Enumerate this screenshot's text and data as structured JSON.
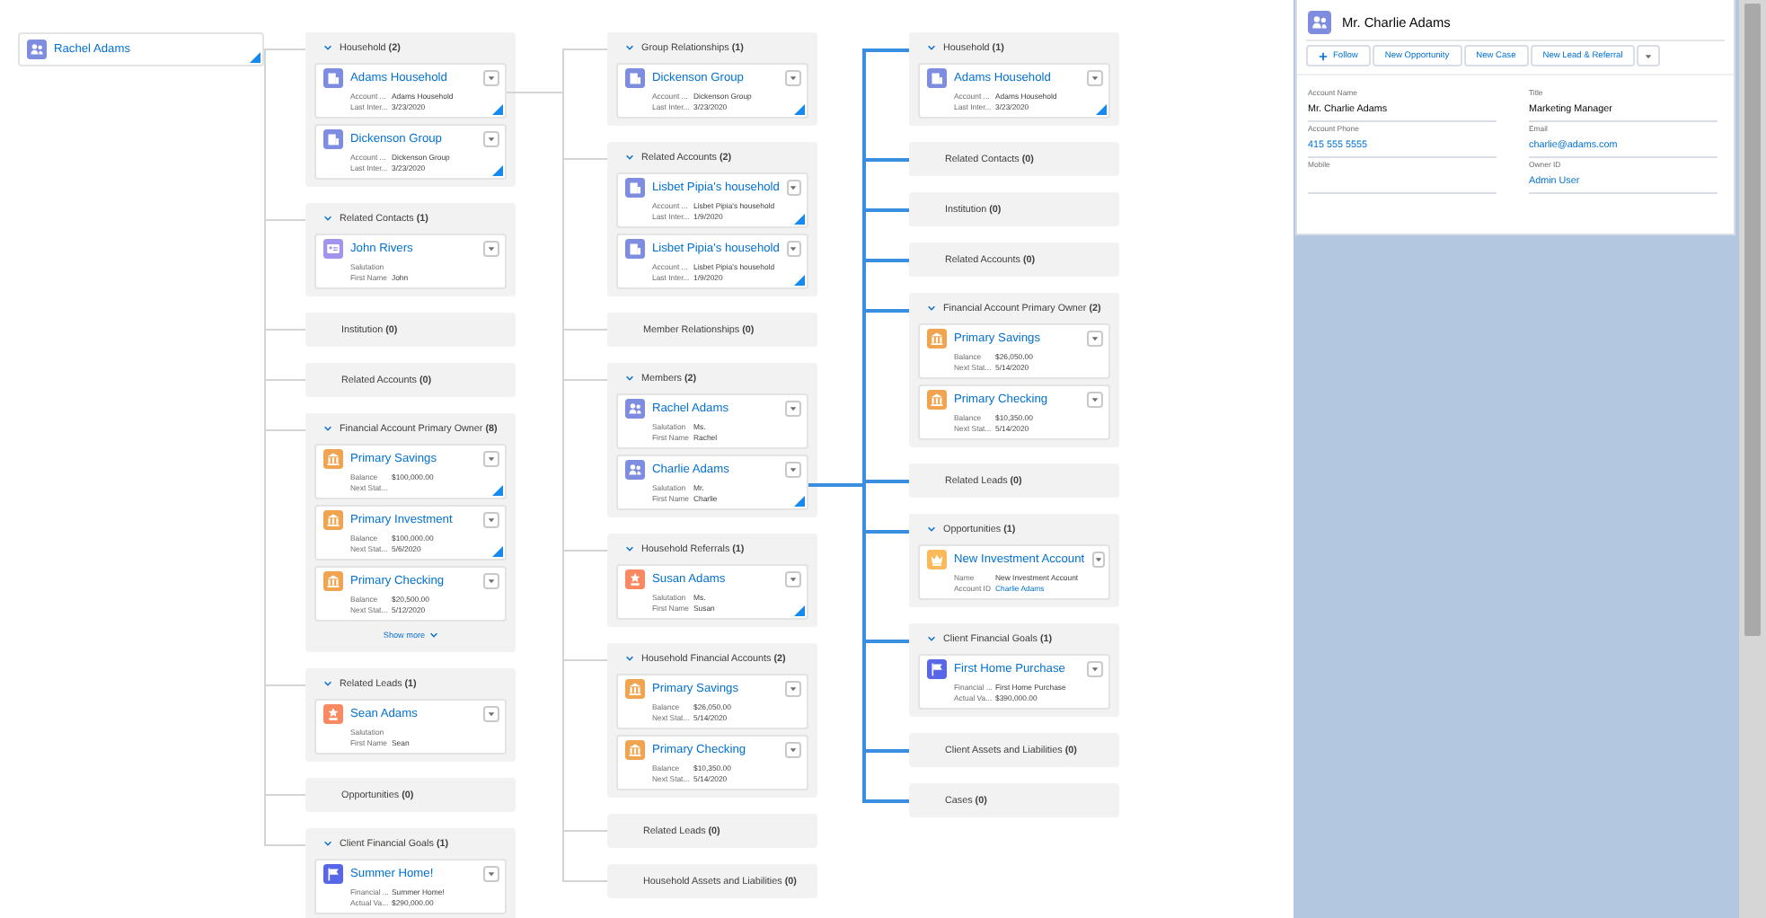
{
  "root_record": {
    "title": "Rachel Adams",
    "kind": "person_account",
    "expandable": true
  },
  "columns": [
    {
      "highlighted": false,
      "groups": [
        {
          "title": "Household **(2)**",
          "expanded": true,
          "cards": [
            {
              "title": "Adams Household",
              "kind": "account",
              "expandable": true,
              "expanded": true,
              "fields": [
                {
                  "label": "Account ...",
                  "value": "Adams Household",
                  "kind": "text"
                },
                {
                  "label": "Last Inter...",
                  "value": "3/23/2020",
                  "kind": "text"
                }
              ]
            },
            {
              "title": "Dickenson Group",
              "kind": "account",
              "expandable": true,
              "expanded": false,
              "fields": [
                {
                  "label": "Account ...",
                  "value": "Dickenson Group",
                  "kind": "text"
                },
                {
                  "label": "Last Inter...",
                  "value": "3/23/2020",
                  "kind": "text"
                }
              ]
            }
          ]
        },
        {
          "title": "Related Contacts **(1)**",
          "expanded": true,
          "cards": [
            {
              "title": "John Rivers",
              "kind": "contact",
              "expandable": false,
              "expanded": false,
              "fields": [
                {
                  "label": "Salutation"
                },
                {
                  "label": "First Name",
                  "value": "John",
                  "kind": "text"
                }
              ]
            }
          ]
        },
        {
          "title": "Institution **(0)**",
          "expanded": false
        },
        {
          "title": "Related Accounts **(0)**",
          "expanded": false
        },
        {
          "title": "Financial Account Primary Owner **(8)**",
          "expanded": true,
          "show_more": "Show more",
          "cards": [
            {
              "title": "Primary Savings",
              "kind": "financial_account",
              "expandable": true,
              "expanded": false,
              "fields": [
                {
                  "label": "Balance",
                  "value": "$100,000.00",
                  "kind": "text"
                },
                {
                  "label": "Next Stat..."
                }
              ]
            },
            {
              "title": "Primary Investment",
              "kind": "financial_account",
              "expandable": true,
              "expanded": false,
              "fields": [
                {
                  "label": "Balance",
                  "value": "$100,000.00",
                  "kind": "text"
                },
                {
                  "label": "Next Stat...",
                  "value": "5/6/2020",
                  "kind": "text"
                }
              ]
            },
            {
              "title": "Primary Checking",
              "kind": "financial_account",
              "expandable": false,
              "expanded": false,
              "fields": [
                {
                  "label": "Balance",
                  "value": "$20,500.00",
                  "kind": "text"
                },
                {
                  "label": "Next Stat...",
                  "value": "5/12/2020",
                  "kind": "text"
                }
              ]
            }
          ]
        },
        {
          "title": "Related Leads **(1)**",
          "expanded": true,
          "cards": [
            {
              "title": "Sean Adams",
              "kind": "lead",
              "expandable": false,
              "expanded": false,
              "fields": [
                {
                  "label": "Salutation"
                },
                {
                  "label": "First Name",
                  "value": "Sean",
                  "kind": "text"
                }
              ]
            }
          ]
        },
        {
          "title": "Opportunities **(0)**",
          "expanded": false
        },
        {
          "title": "Client Financial Goals **(1)**",
          "expanded": true,
          "cards": [
            {
              "title": "Summer Home!",
              "kind": "goal",
              "expandable": false,
              "expanded": false,
              "fields": [
                {
                  "label": "Financial ...",
                  "value": "Summer Home!",
                  "kind": "text"
                },
                {
                  "label": "Actual Va...",
                  "value": "$290,000.00",
                  "kind": "text"
                }
              ]
            }
          ]
        }
      ]
    },
    {
      "highlighted": false,
      "groups": [
        {
          "title": "Group Relationships **(1)**",
          "expanded": true,
          "cards": [
            {
              "title": "Dickenson Group",
              "kind": "account",
              "expandable": true,
              "expanded": false,
              "fields": [
                {
                  "label": "Account ...",
                  "value": "Dickenson Group",
                  "kind": "text"
                },
                {
                  "label": "Last Inter...",
                  "value": "3/23/2020",
                  "kind": "text"
                }
              ]
            }
          ]
        },
        {
          "title": "Related Accounts **(2)**",
          "expanded": true,
          "cards": [
            {
              "title": "Lisbet Pipia's household",
              "kind": "account",
              "expandable": true,
              "expanded": false,
              "fields": [
                {
                  "label": "Account ...",
                  "value": "Lisbet Pipia's household",
                  "kind": "text"
                },
                {
                  "label": "Last Inter...",
                  "value": "1/9/2020",
                  "kind": "text"
                }
              ]
            },
            {
              "title": "Lisbet Pipia's household",
              "kind": "account",
              "expandable": true,
              "expanded": false,
              "fields": [
                {
                  "label": "Account ...",
                  "value": "Lisbet Pipia's household",
                  "kind": "text"
                },
                {
                  "label": "Last Inter...",
                  "value": "1/9/2020",
                  "kind": "text"
                }
              ]
            }
          ]
        },
        {
          "title": "Member Relationships **(0)**",
          "expanded": false
        },
        {
          "title": "Members **(2)**",
          "expanded": true,
          "cards": [
            {
              "title": "Rachel Adams",
              "kind": "person_account",
              "expandable": false,
              "expanded": false,
              "fields": [
                {
                  "label": "Salutation",
                  "value": "Ms.",
                  "kind": "text"
                },
                {
                  "label": "First Name",
                  "value": "Rachel",
                  "kind": "text"
                }
              ]
            },
            {
              "title": "Charlie Adams",
              "kind": "person_account",
              "expandable": true,
              "expanded": true,
              "fields": [
                {
                  "label": "Salutation",
                  "value": "Mr.",
                  "kind": "text"
                },
                {
                  "label": "First Name",
                  "value": "Charlie",
                  "kind": "text"
                }
              ]
            }
          ]
        },
        {
          "title": "Household Referrals **(1)**",
          "expanded": true,
          "cards": [
            {
              "title": "Susan Adams",
              "kind": "lead",
              "expandable": true,
              "expanded": false,
              "fields": [
                {
                  "label": "Salutation",
                  "value": "Ms.",
                  "kind": "text"
                },
                {
                  "label": "First Name",
                  "value": "Susan",
                  "kind": "text"
                }
              ]
            }
          ]
        },
        {
          "title": "Household Financial Accounts **(2)**",
          "expanded": true,
          "cards": [
            {
              "title": "Primary Savings",
              "kind": "financial_account",
              "expandable": false,
              "expanded": false,
              "fields": [
                {
                  "label": "Balance",
                  "value": "$26,050.00",
                  "kind": "text"
                },
                {
                  "label": "Next Stat...",
                  "value": "5/14/2020",
                  "kind": "text"
                }
              ]
            },
            {
              "title": "Primary Checking",
              "kind": "financial_account",
              "expandable": false,
              "expanded": false,
              "fields": [
                {
                  "label": "Balance",
                  "value": "$10,350.00",
                  "kind": "text"
                },
                {
                  "label": "Next Stat...",
                  "value": "5/14/2020",
                  "kind": "text"
                }
              ]
            }
          ]
        },
        {
          "title": "Related Leads **(0)**",
          "expanded": false
        },
        {
          "title": "Household Assets and Liabilities **(0)**",
          "expanded": false
        }
      ]
    },
    {
      "highlighted": true,
      "groups": [
        {
          "title": "Household **(1)**",
          "expanded": true,
          "cards": [
            {
              "title": "Adams Household",
              "kind": "account",
              "expandable": true,
              "expanded": false,
              "fields": [
                {
                  "label": "Account ...",
                  "value": "Adams Household",
                  "kind": "text"
                },
                {
                  "label": "Last Inter...",
                  "value": "3/23/2020",
                  "kind": "text"
                }
              ]
            }
          ]
        },
        {
          "title": "Related Contacts **(0)**",
          "expanded": false
        },
        {
          "title": "Institution **(0)**",
          "expanded": false
        },
        {
          "title": "Related Accounts **(0)**",
          "expanded": false
        },
        {
          "title": "Financial Account Primary Owner **(2)**",
          "expanded": true,
          "cards": [
            {
              "title": "Primary Savings",
              "kind": "financial_account",
              "expandable": false,
              "expanded": false,
              "fields": [
                {
                  "label": "Balance",
                  "value": "$26,050.00",
                  "kind": "text"
                },
                {
                  "label": "Next Stat...",
                  "value": "5/14/2020",
                  "kind": "text"
                }
              ]
            },
            {
              "title": "Primary Checking",
              "kind": "financial_account",
              "expandable": false,
              "expanded": false,
              "fields": [
                {
                  "label": "Balance",
                  "value": "$10,350.00",
                  "kind": "text"
                },
                {
                  "label": "Next Stat...",
                  "value": "5/14/2020",
                  "kind": "text"
                }
              ]
            }
          ]
        },
        {
          "title": "Related Leads **(0)**",
          "expanded": false
        },
        {
          "title": "Opportunities **(1)**",
          "expanded": true,
          "cards": [
            {
              "title": "New Investment Account",
              "kind": "opportunity",
              "expandable": false,
              "expanded": false,
              "fields": [
                {
                  "label": "Name",
                  "value": "New Investment Account",
                  "kind": "text"
                },
                {
                  "label": "Account ID",
                  "value": "Charlie Adams",
                  "kind": "link"
                }
              ]
            }
          ]
        },
        {
          "title": "Client Financial Goals **(1)**",
          "expanded": true,
          "cards": [
            {
              "title": "First Home Purchase",
              "kind": "goal",
              "expandable": false,
              "expanded": false,
              "fields": [
                {
                  "label": "Financial ...",
                  "value": "First Home Purchase",
                  "kind": "text"
                },
                {
                  "label": "Actual Va...",
                  "value": "$390,000.00",
                  "kind": "text"
                }
              ]
            }
          ]
        },
        {
          "title": "Client Assets and Liabilities **(0)**",
          "expanded": false
        },
        {
          "title": "Cases **(0)**",
          "expanded": false
        }
      ]
    }
  ],
  "detail_panel": {
    "title": "Mr. Charlie Adams",
    "kind": "person_account",
    "actions": [
      {
        "label": "Follow",
        "kind": "follow"
      },
      {
        "label": "New Opportunity",
        "kind": "action"
      },
      {
        "label": "New Case",
        "kind": "action"
      },
      {
        "label": "New Lead & Referral",
        "kind": "action"
      }
    ],
    "fields": [
      {
        "label": "Account Name",
        "value": "Mr. Charlie Adams",
        "kind": "text"
      },
      {
        "label": "Title",
        "value": "Marketing Manager",
        "kind": "text"
      },
      {
        "label": "Account Phone",
        "value": "415 555 5555",
        "kind": "link"
      },
      {
        "label": "Email",
        "value": "charlie@adams.com",
        "kind": "link"
      },
      {
        "label": "Mobile"
      },
      {
        "label": "Owner ID",
        "value": "Admin User",
        "kind": "link"
      }
    ]
  }
}
